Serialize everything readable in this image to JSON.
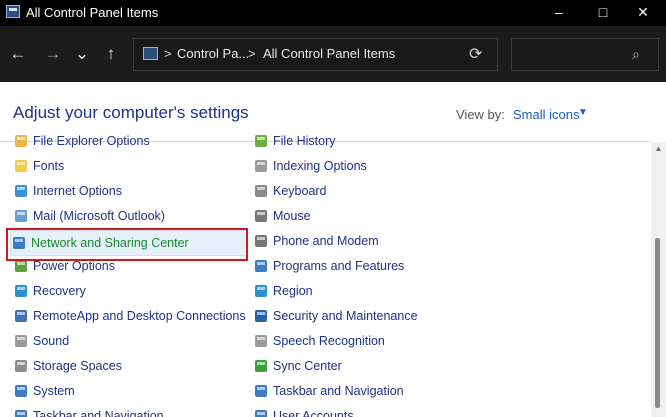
{
  "window": {
    "title": "All Control Panel Items",
    "minimize_label": "–",
    "maximize_label": "□",
    "close_label": "✕"
  },
  "nav": {
    "back_label": "←",
    "forward_label": "→",
    "recent_label": "⌄",
    "up_label": "↑",
    "separator": ">",
    "breadcrumbs": [
      "Control Pa...",
      "All Control Panel Items"
    ],
    "refresh_label": "⟳",
    "search_placeholder": "",
    "search_icon_label": "⌕"
  },
  "content": {
    "heading": "Adjust your computer's settings",
    "view_by_label": "View by:",
    "view_by_value": "Small icons",
    "view_by_arrow": "▼"
  },
  "left_items": [
    {
      "label": "File Explorer Options",
      "icon": "folder-options-icon",
      "color": "#e8b84a"
    },
    {
      "label": "Fonts",
      "icon": "fonts-icon",
      "color": "#f2c94c"
    },
    {
      "label": "Internet Options",
      "icon": "globe-icon",
      "color": "#3a8fd6"
    },
    {
      "label": "Mail (Microsoft Outlook)",
      "icon": "mail-icon",
      "color": "#6aa0cf"
    },
    {
      "label": "Network and Sharing Center",
      "icon": "network-icon",
      "color": "#3c7cc4"
    },
    {
      "label": "Power Options",
      "icon": "power-icon",
      "color": "#5aa33c"
    },
    {
      "label": "Recovery",
      "icon": "recovery-icon",
      "color": "#2f8fcf"
    },
    {
      "label": "RemoteApp and Desktop Connections",
      "icon": "remote-desktop-icon",
      "color": "#3f6fb8"
    },
    {
      "label": "Sound",
      "icon": "speaker-icon",
      "color": "#9a9a9a"
    },
    {
      "label": "Storage Spaces",
      "icon": "storage-icon",
      "color": "#8c8c8c"
    },
    {
      "label": "System",
      "icon": "system-icon",
      "color": "#3c7cc4"
    },
    {
      "label": "Taskbar and Navigation",
      "icon": "taskbar-icon",
      "color": "#3c7cc4"
    }
  ],
  "right_items": [
    {
      "label": "File History",
      "icon": "file-history-icon",
      "color": "#6cae3f"
    },
    {
      "label": "Indexing Options",
      "icon": "indexing-icon",
      "color": "#9a9a9a"
    },
    {
      "label": "Keyboard",
      "icon": "keyboard-icon",
      "color": "#8a8a8a"
    },
    {
      "label": "Mouse",
      "icon": "mouse-icon",
      "color": "#777"
    },
    {
      "label": "Phone and Modem",
      "icon": "phone-icon",
      "color": "#777"
    },
    {
      "label": "Programs and Features",
      "icon": "programs-icon",
      "color": "#3c7cc4"
    },
    {
      "label": "Region",
      "icon": "region-icon",
      "color": "#2f8fcf"
    },
    {
      "label": "Security and Maintenance",
      "icon": "flag-icon",
      "color": "#2a5fb0"
    },
    {
      "label": "Speech Recognition",
      "icon": "microphone-icon",
      "color": "#9a9a9a"
    },
    {
      "label": "Sync Center",
      "icon": "sync-icon",
      "color": "#3aa03a"
    },
    {
      "label": "Taskbar and Navigation",
      "icon": "taskbar-icon",
      "color": "#3c7cc4"
    },
    {
      "label": "User Accounts",
      "icon": "user-icon",
      "color": "#3c7cc4"
    }
  ],
  "selected_item": "Network and Sharing Center",
  "colors": {
    "highlight_border": "#d01b1b",
    "link_green": "#178a2a",
    "item_blue": "#1e3287"
  }
}
